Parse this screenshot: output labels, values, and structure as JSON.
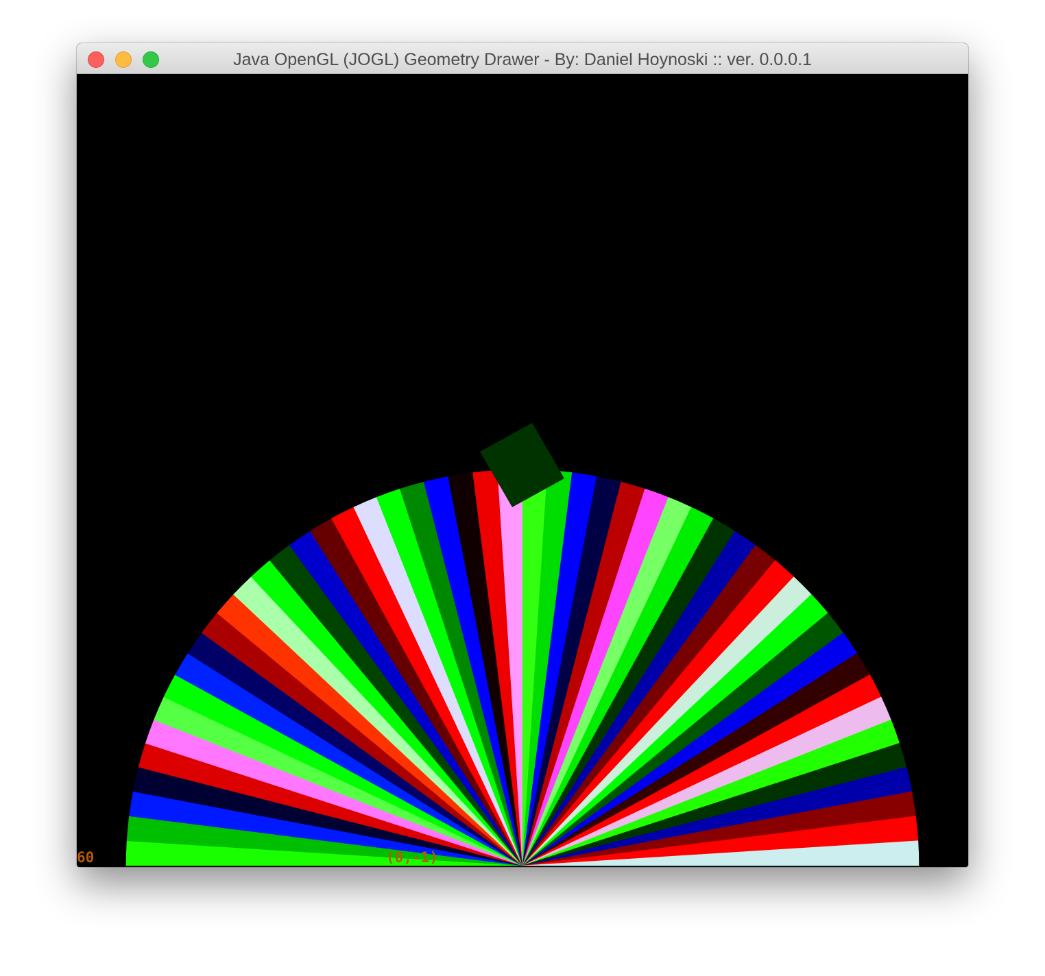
{
  "window": {
    "title": "Java OpenGL (JOGL) Geometry Drawer - By: Daniel Hoynoski :: ver. 0.0.0.1"
  },
  "canvas": {
    "background": "#000000",
    "fps_text": "60",
    "coordinate_text": "(0,-1)",
    "hud_text_color": "#b85a00",
    "square_color": "#003300",
    "fan_segment_colors": [
      "#1aff00",
      "#00bf00",
      "#0019ff",
      "#000033",
      "#dd0000",
      "#ff77ff",
      "#55ff44",
      "#00ff00",
      "#0022ff",
      "#000066",
      "#aa0000",
      "#ff3300",
      "#aaffaa",
      "#00ff00",
      "#004400",
      "#0000cc",
      "#660000",
      "#ff0000",
      "#ddddff",
      "#00ff00",
      "#008800",
      "#0000ff",
      "#110000",
      "#ee0000",
      "#ff99ff",
      "#33ff11",
      "#00dd00",
      "#0000ff",
      "#000044",
      "#bb0000",
      "#ff44ff",
      "#77ff66",
      "#00ee00",
      "#003300",
      "#0000aa",
      "#770000",
      "#ff0000",
      "#cceedd",
      "#00ff00",
      "#005500",
      "#0000ee",
      "#330000",
      "#ff0000",
      "#eebbee",
      "#22ff00",
      "#003300",
      "#0000aa",
      "#880000",
      "#ff0000",
      "#cceeee"
    ]
  }
}
